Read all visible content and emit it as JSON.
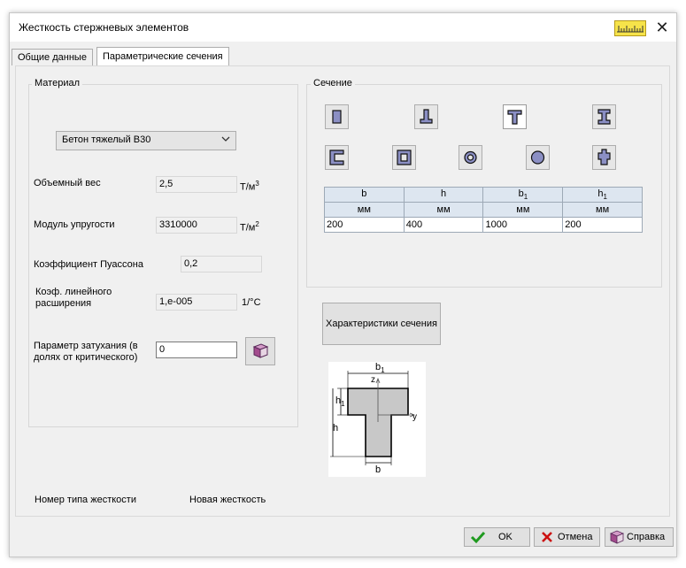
{
  "window": {
    "title": "Жесткость стержневых элементов"
  },
  "tabs": [
    {
      "label": "Общие данные"
    },
    {
      "label": "Параметрические сечения"
    }
  ],
  "material": {
    "group_label": "Материал",
    "selected": "Бетон тяжелый В30",
    "fields": {
      "volume_weight": {
        "label": "Объемный вес",
        "value": "2,5",
        "unit_base": "Т/м",
        "unit_sup": "3"
      },
      "elastic_modulus": {
        "label": "Модуль упругости",
        "value": "3310000",
        "unit_base": "Т/м",
        "unit_sup": "2"
      },
      "poisson": {
        "label": "Коэффициент Пуассона",
        "value": "0,2"
      },
      "thermal": {
        "label_line1": "Коэф. линейного",
        "label_line2": "расширения",
        "value": "1,e-005",
        "unit": "1/°C"
      },
      "damping": {
        "label_line1": "Параметр затухания (в",
        "label_line2": "долях от критического)",
        "value": "0"
      }
    }
  },
  "section": {
    "group_label": "Сечение",
    "shapes_row1": [
      "rectangle-section-icon",
      "inverted-t-section-icon",
      "t-section-icon",
      "i-beam-section-icon"
    ],
    "shapes_row2": [
      "channel-section-icon",
      "box-section-icon",
      "ring-section-icon",
      "circle-section-icon",
      "cross-section-icon"
    ],
    "selected_shape": "t-section-icon",
    "table": {
      "headers": [
        "b",
        "h",
        "b",
        "h"
      ],
      "header_subs": [
        "",
        "",
        "1",
        "1"
      ],
      "units": [
        "мм",
        "мм",
        "мм",
        "мм"
      ],
      "values": [
        "200",
        "400",
        "1000",
        "200"
      ]
    },
    "characteristics_button": "Характеристики сечения",
    "diagram_labels": {
      "b1": "b",
      "b1_sub": "1",
      "h1": "h",
      "h1_sub": "1",
      "h": "h",
      "b": "b",
      "z": "z",
      "y": "y"
    }
  },
  "stiffness": {
    "label": "Номер типа жесткости",
    "value": "Новая жесткость"
  },
  "footer": {
    "ok": "OK",
    "cancel": "Отмена",
    "help": "Справка"
  },
  "colors": {
    "shape_fill": "#8b8fc4",
    "ok_check": "#1f9a1f",
    "cancel_x": "#cc1111"
  }
}
